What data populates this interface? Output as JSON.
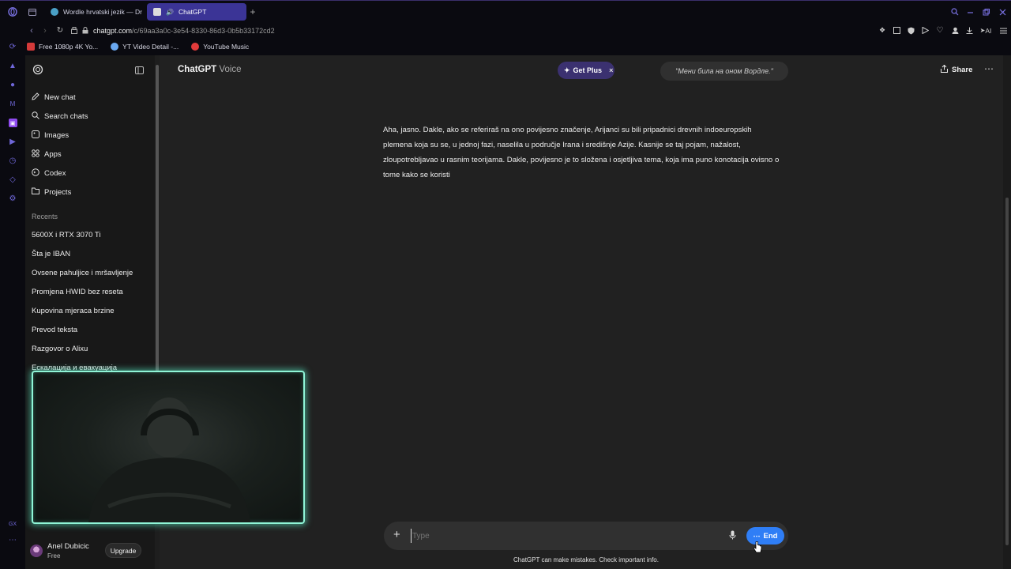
{
  "browser": {
    "tabs": [
      {
        "label": "Wordle hrvatski jezik — Dr",
        "active": false
      },
      {
        "label": "ChatGPT",
        "active": true
      }
    ],
    "url_host": "chatgpt.com",
    "url_path": "/c/69aa3a0c-3e54-8330-86d3-0b5b33172cd2",
    "bookmarks": [
      "Free 1080p 4K Yo...",
      "YT Video Detail -...",
      "YouTube Music"
    ],
    "ai_label": "AI"
  },
  "sidebar": {
    "nav": [
      {
        "label": "New chat",
        "icon": "edit-icon"
      },
      {
        "label": "Search chats",
        "icon": "search-icon"
      },
      {
        "label": "Images",
        "icon": "image-icon"
      },
      {
        "label": "Apps",
        "icon": "apps-icon"
      },
      {
        "label": "Codex",
        "icon": "codex-icon"
      },
      {
        "label": "Projects",
        "icon": "folder-icon"
      }
    ],
    "recents_heading": "Recents",
    "recents": [
      "5600X i RTX 3070 Ti",
      "Šta je IBAN",
      "Ovsene pahuljice i mršavljenje",
      "Promjena HWID bez reseta",
      "Kupovina mjeraca brzine",
      "Prevod teksta",
      "Razgovor o Alixu",
      "Ескалација и евакуација"
    ],
    "user": {
      "name": "Anel Dubicic",
      "plan": "Free",
      "upgrade_label": "Upgrade"
    }
  },
  "header": {
    "title": "ChatGPT",
    "subtitle": "Voice",
    "get_plus_label": "Get Plus",
    "transcript_chip": "\"Мени била на оном Вордле.\"",
    "share_label": "Share"
  },
  "conversation": {
    "assistant_message": "Aha, jasno. Dakle, ako se referiraš na ono povijesno značenje, Arijanci su bili pripadnici drevnih indoeuropskih plemena koja su se, u jednoj fazi, naselila u područje Irana i središnje Azije. Kasnije se taj pojam, nažalost, zloupotrebljavao u rasnim teorijama. Dakle, povijesno je to složena i osjetljiva tema, koja ima puno konotacija ovisno o tome kako se koristi"
  },
  "composer": {
    "placeholder": "Type",
    "end_label": "End"
  },
  "footer_note": "ChatGPT can make mistakes. Check important info.",
  "colors": {
    "accent": "#3b3496",
    "end_button": "#2f7ef6",
    "get_plus_bg": "#3b3170",
    "webcam_border": "#8ff5d7"
  }
}
